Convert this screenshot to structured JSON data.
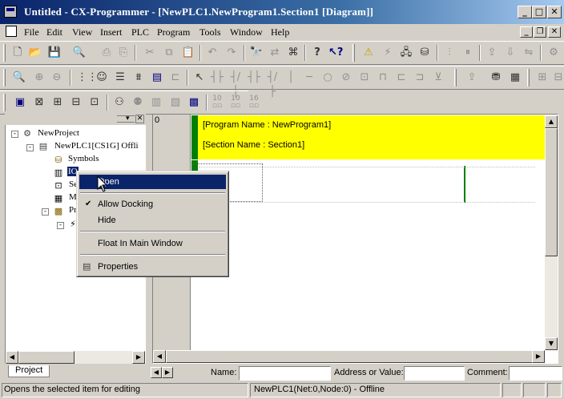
{
  "window": {
    "title": "Untitled - CX-Programmer - [NewPLC1.NewProgram1.Section1 [Diagram]]",
    "minimize": "_",
    "maximize": "□",
    "close": "✕"
  },
  "menu": {
    "items": [
      "File",
      "Edit",
      "View",
      "Insert",
      "PLC",
      "Program",
      "Tools",
      "Window",
      "Help"
    ]
  },
  "toolbar_top": {
    "icons": [
      "new-icon",
      "open-icon",
      "save-icon",
      "print-preview-icon",
      "print-icon",
      "cut-icon",
      "copy-icon",
      "paste-icon",
      "undo-icon",
      "redo-icon",
      "find-icon",
      "replace-icon",
      "help-icon",
      "context-help-icon",
      "warning-icon",
      "online-icon",
      "monitor-icon",
      "transfer-icon"
    ]
  },
  "project_tree": {
    "root": "NewProject",
    "plc": "NewPLC1[CS1G] Offli",
    "symbols": "Symbols",
    "io_table": "IO Table",
    "settings_short": "Se",
    "memory_short": "M",
    "programs_short": "Pr",
    "tab": "Project"
  },
  "context_menu": {
    "items": [
      "Open",
      "Allow Docking",
      "Hide",
      "Float In Main Window",
      "Properties"
    ],
    "checked": "Allow Docking"
  },
  "diagram": {
    "rung_number": "0",
    "program_name": "[Program Name : NewProgram1]",
    "section_name": "[Section Name : Section1]",
    "highlight_color": "#ffff00",
    "rail_color": "#008000"
  },
  "info_bar": {
    "name_label": "Name:",
    "address_label": "Address or Value:",
    "comment_label": "Comment:"
  },
  "statusbar": {
    "hint": "Opens the selected item for editing",
    "plc_status": "NewPLC1(Net:0,Node:0) - Offline"
  }
}
